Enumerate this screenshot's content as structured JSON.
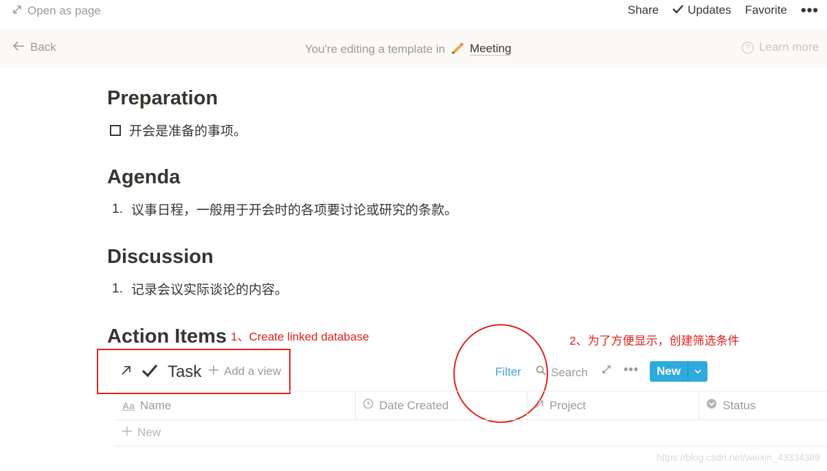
{
  "topbar": {
    "open_as_page": "Open as page",
    "share": "Share",
    "updates": "Updates",
    "favorite": "Favorite",
    "more": "•••"
  },
  "banner": {
    "back": "Back",
    "editing_text": "You're editing a template in",
    "template_name": "Meeting",
    "learn_more": "Learn more"
  },
  "sections": {
    "preparation": {
      "title": "Preparation",
      "todo": "开会是准备的事项。"
    },
    "agenda": {
      "title": "Agenda",
      "num": "1.",
      "item": "议事日程，一般用于开会时的各项要讨论或研究的条款。"
    },
    "discussion": {
      "title": "Discussion",
      "num": "1.",
      "item": "记录会议实际谈论的内容。"
    },
    "action_items": {
      "title": "Action Items"
    }
  },
  "annotations": {
    "first": "1、Create linked database",
    "second": "2、为了方便显示，创建筛选条件",
    "color": "#e0201c"
  },
  "database": {
    "title": "Task",
    "add_view": "Add a view",
    "filter": "Filter",
    "search": "Search",
    "new_button": "New",
    "columns": [
      {
        "label": "Name",
        "icon": "text-icon"
      },
      {
        "label": "Date Created",
        "icon": "clock-icon"
      },
      {
        "label": "Project",
        "icon": "relation-arrow-icon"
      },
      {
        "label": "Status",
        "icon": "select-icon"
      }
    ],
    "new_row": "New"
  },
  "watermark": "https://blog.csdn.net/weixin_43334389",
  "colors": {
    "accent": "#2eaadc",
    "filter": "#46a3d9",
    "banner_bg": "#fbf9f5"
  }
}
